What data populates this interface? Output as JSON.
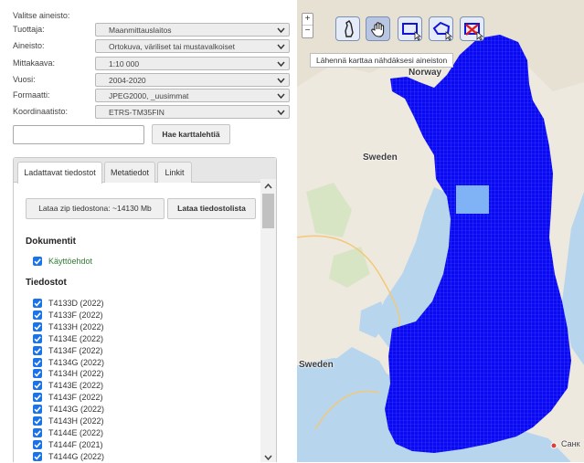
{
  "form": {
    "intro": "Valitse aineisto:",
    "rows": [
      {
        "label": "Tuottaja:",
        "value": "Maanmittauslaitos"
      },
      {
        "label": "Aineisto:",
        "value": "Ortokuva, väriliset tai mustavalkoiset"
      },
      {
        "label": "Mittakaava:",
        "value": "1:10 000"
      },
      {
        "label": "Vuosi:",
        "value": "2004-2020"
      },
      {
        "label": "Formaatti:",
        "value": "JPEG2000, _uusimmat"
      },
      {
        "label": "Koordinaatisto:",
        "value": "ETRS-TM35FIN"
      }
    ],
    "search_value": "",
    "search_button": "Hae karttalehtiä"
  },
  "tabs": [
    "Ladattavat tiedostot",
    "Metatiedot",
    "Linkit"
  ],
  "downloads": {
    "zip_button": "Lataa zip tiedostona: ~14130 Mb",
    "list_button": "Lataa tiedostolista"
  },
  "documents": {
    "title": "Dokumentit",
    "items": [
      {
        "label": "Käyttöehdot",
        "checked": true
      }
    ]
  },
  "files": {
    "title": "Tiedostot",
    "items": [
      {
        "label": "T4133D (2022)",
        "checked": true
      },
      {
        "label": "T4133F (2022)",
        "checked": true
      },
      {
        "label": "T4133H (2022)",
        "checked": true
      },
      {
        "label": "T4134E (2022)",
        "checked": true
      },
      {
        "label": "T4134F (2022)",
        "checked": true
      },
      {
        "label": "T4134G (2022)",
        "checked": true
      },
      {
        "label": "T4134H (2022)",
        "checked": true
      },
      {
        "label": "T4143E (2022)",
        "checked": true
      },
      {
        "label": "T4143F (2022)",
        "checked": true
      },
      {
        "label": "T4143G (2022)",
        "checked": true
      },
      {
        "label": "T4143H (2022)",
        "checked": true
      },
      {
        "label": "T4144E (2022)",
        "checked": true
      },
      {
        "label": "T4144F (2021)",
        "checked": true
      },
      {
        "label": "T4144G (2022)",
        "checked": true
      }
    ]
  },
  "map": {
    "zoom_in": "+",
    "zoom_out": "−",
    "tools": [
      {
        "icon": "finland-outline-icon",
        "active": false
      },
      {
        "icon": "hand-pan-icon",
        "active": true
      },
      {
        "icon": "rectangle-select-icon",
        "active": false
      },
      {
        "icon": "polygon-select-icon",
        "active": false
      },
      {
        "icon": "clear-selection-icon",
        "active": false
      }
    ],
    "tooltip": "Lähennä karttaa nähdäksesi aineiston",
    "labels": {
      "norway": "Norway",
      "sweden_north": "Sweden",
      "sweden_south": "Sweden",
      "spb": "Санк"
    },
    "colors": {
      "coverage": "#0a0af2",
      "selected": "#7fb3f5",
      "water": "#b7d6ed",
      "land": "#eee9df"
    }
  }
}
